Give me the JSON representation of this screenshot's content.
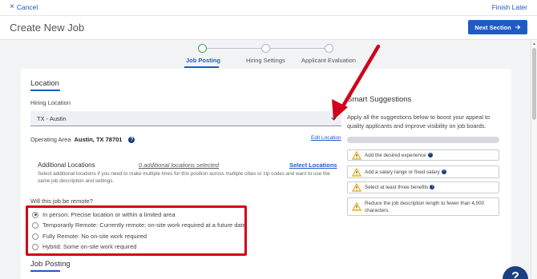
{
  "topbar": {
    "cancel_label": "Cancel",
    "finish_label": "Finish Later"
  },
  "header": {
    "title": "Create New Job",
    "next_label": "Next Section"
  },
  "steps": [
    {
      "label": "Job Posting",
      "active": true
    },
    {
      "label": "Hiring Settings",
      "active": false
    },
    {
      "label": "Applicant Evaluation",
      "active": false
    }
  ],
  "location": {
    "section_title": "Location",
    "hiring_location_label": "Hiring Location",
    "hiring_location_value": "TX - Austin",
    "operating_area_label": "Operating Area",
    "operating_area_value": "Austin, TX 78701",
    "edit_location_label": "Edit Location",
    "additional_title": "Additional Locations",
    "additional_count": "0 additional locations selected",
    "select_locations_label": "Select Locations",
    "additional_desc": "Select additional locations if you need to make multiple hires for this position across multiple cities or zip codes and want to use the same job description and settings."
  },
  "remote": {
    "question": "Will this job be remote?",
    "options": [
      {
        "label": "In person: Precise location or within a limited area",
        "selected": true
      },
      {
        "label": "Temporarily Remote: Currently remote; on-site work required at a future date",
        "selected": false
      },
      {
        "label": "Fully Remote: No on-site work required",
        "selected": false
      },
      {
        "label": "Hybrid: Some on-site work required",
        "selected": false
      }
    ]
  },
  "job_posting": {
    "section_title": "Job Posting"
  },
  "smart_suggestions": {
    "title": "Smart Suggestions",
    "description": "Apply all the suggestions below to boost your appeal to quality applicants and improve visibility on job boards.",
    "items": [
      "Add the desired experience",
      "Add a salary range or fixed salary",
      "Select at least three benefits",
      "Reduce the job description length to fewer than 4,000 characters."
    ]
  },
  "help_fab_label": "?",
  "colors": {
    "primary": "#1f5bc5",
    "annotation": "#d0021b",
    "active_step": "#3aa14a",
    "warning": "#e5a800"
  },
  "icons": [
    "close-icon",
    "arrow-right-icon",
    "chevron-down-icon",
    "help-icon",
    "warning-icon"
  ]
}
